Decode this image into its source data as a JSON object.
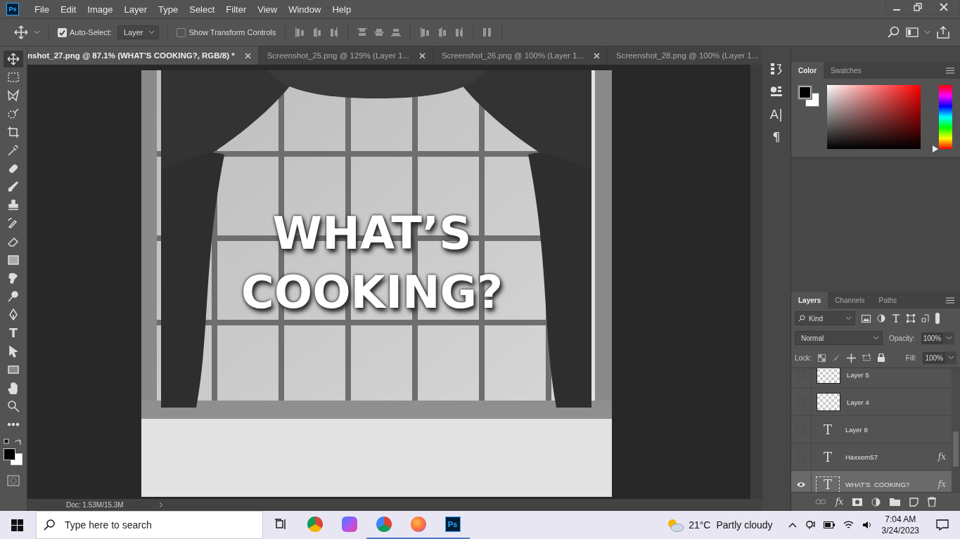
{
  "app_logo": "Ps",
  "menu": [
    "File",
    "Edit",
    "Image",
    "Layer",
    "Type",
    "Select",
    "Filter",
    "View",
    "Window",
    "Help"
  ],
  "options_bar": {
    "auto_select": {
      "label": "Auto-Select:",
      "checked": true
    },
    "target": "Layer",
    "transform_controls": {
      "label": "Show Transform Controls",
      "checked": false
    }
  },
  "tabs": [
    {
      "label": "nshot_27.png @ 87.1% (WHAT’S  COOKING?, RGB/8) *",
      "selected": true
    },
    {
      "label": "Screenshot_25.png @ 129% (Layer 1...",
      "selected": false
    },
    {
      "label": "Screenshot_26.png @ 100% (Layer 1...",
      "selected": false
    },
    {
      "label": "Screenshot_28.png @ 100% (Layer 1...",
      "selected": false
    }
  ],
  "tools": [
    {
      "kind": "move",
      "selected": true
    },
    {
      "kind": "marquee",
      "selected": false
    },
    {
      "kind": "lasso",
      "selected": false
    },
    {
      "kind": "quickselect",
      "selected": false
    },
    {
      "kind": "crop",
      "selected": false
    },
    {
      "kind": "eyedropper",
      "selected": false
    },
    {
      "kind": "healing",
      "selected": false
    },
    {
      "kind": "brush",
      "selected": false
    },
    {
      "kind": "stamp",
      "selected": false
    },
    {
      "kind": "historybrush",
      "selected": false
    },
    {
      "kind": "eraser",
      "selected": false
    },
    {
      "kind": "gradient",
      "selected": false
    },
    {
      "kind": "smudge",
      "selected": false
    },
    {
      "kind": "dodge",
      "selected": false
    },
    {
      "kind": "pen",
      "selected": false
    },
    {
      "kind": "type",
      "glyph": "T",
      "selected": false
    },
    {
      "kind": "pathselect",
      "selected": false
    },
    {
      "kind": "rectangle",
      "selected": false
    },
    {
      "kind": "hand",
      "selected": false
    },
    {
      "kind": "zoom",
      "selected": false
    },
    {
      "kind": "more",
      "selected": false
    }
  ],
  "canvas": {
    "text_lines": [
      "WHAT’S",
      "COOKING?"
    ]
  },
  "status_bar": {
    "doc": "Doc: 1.53M/15.3M"
  },
  "dock": [
    {
      "kind": "history"
    },
    {
      "kind": "properties"
    },
    {
      "kind": "glyph",
      "glyph": "A|"
    },
    {
      "kind": "glyph",
      "glyph": "¶"
    }
  ],
  "color_panel": {
    "tabs": [
      {
        "label": "Color",
        "selected": true
      },
      {
        "label": "Swatches",
        "selected": false
      }
    ],
    "hue": {
      "level": 0
    }
  },
  "layers_panel": {
    "tabs": [
      {
        "label": "Layers",
        "selected": true
      },
      {
        "label": "Channels",
        "selected": false
      },
      {
        "label": "Paths",
        "selected": false
      }
    ],
    "filter": "Kind",
    "blend_mode": "Normal",
    "opacity_label": "Opacity:",
    "opacity": "100%",
    "lock_label": "Lock:",
    "fill_label": "Fill:",
    "fill": "100%",
    "layers": [
      {
        "name": "Layer 5",
        "kind": "raster",
        "visible": false,
        "selected": false
      },
      {
        "name": "Layer 4",
        "kind": "raster",
        "visible": false,
        "selected": false
      },
      {
        "name": "Layer 8",
        "kind": "text",
        "glyph": "T",
        "visible": false,
        "selected": false
      },
      {
        "name": "Haxxern57",
        "kind": "text",
        "glyph": "T",
        "visible": false,
        "selected": false,
        "effects": "fx"
      },
      {
        "name": "WHAT’S  COOKING?",
        "kind": "text",
        "glyph": "T",
        "visible": true,
        "selected": true,
        "effects": "fx"
      }
    ],
    "footer_effects": "fx"
  },
  "taskbar": {
    "search_placeholder": "Type here to search",
    "apps": [
      {
        "kind": "taskview",
        "selected": false
      },
      {
        "kind": "chrome",
        "selected": false
      },
      {
        "kind": "copilot",
        "selected": false
      },
      {
        "kind": "chromealt",
        "selected": true
      },
      {
        "kind": "firefox",
        "selected": true
      },
      {
        "kind": "photoshop",
        "label": "Ps",
        "selected": true
      }
    ],
    "temperature": "21°C",
    "weather": "Partly cloudy",
    "time": "7:04 AM",
    "date": "3/24/2023"
  }
}
